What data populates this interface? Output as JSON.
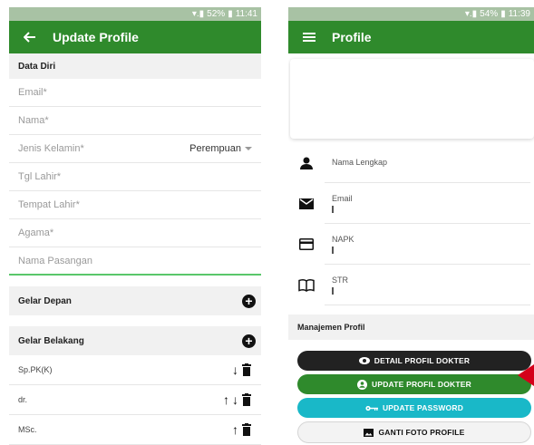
{
  "left_screen": {
    "status": {
      "battery": "52%",
      "time": "11:41"
    },
    "appbar": {
      "title": "Update Profile"
    },
    "data_diri": {
      "header": "Data Diri",
      "fields": [
        {
          "placeholder": "Email*"
        },
        {
          "placeholder": "Nama*"
        },
        {
          "placeholder": "Jenis Kelamin*",
          "value": "Perempuan"
        },
        {
          "placeholder": "Tgl Lahir*"
        },
        {
          "placeholder": "Tempat Lahir*"
        },
        {
          "placeholder": "Agama*"
        },
        {
          "placeholder": "Nama Pasangan"
        }
      ]
    },
    "gelar_depan": {
      "header": "Gelar Depan"
    },
    "gelar_belakang": {
      "header": "Gelar Belakang",
      "items": [
        {
          "label": "Sp.PK(K)"
        },
        {
          "label": "dr."
        },
        {
          "label": "MSc."
        }
      ]
    }
  },
  "right_screen": {
    "status": {
      "battery": "54%",
      "time": "11:39"
    },
    "appbar": {
      "title": "Profile"
    },
    "info": [
      {
        "label": "Nama Lengkap",
        "icon": "person-icon"
      },
      {
        "label": "Email",
        "icon": "mail-icon"
      },
      {
        "label": "NAPK",
        "icon": "card-icon"
      },
      {
        "label": "STR",
        "icon": "book-icon"
      }
    ],
    "manajemen": {
      "header": "Manajemen Profil"
    },
    "buttons": [
      {
        "label": "DETAIL PROFIL DOKTER",
        "icon": "eye-icon"
      },
      {
        "label": "UPDATE PROFIL DOKTER",
        "icon": "account-icon"
      },
      {
        "label": "UPDATE PASSWORD",
        "icon": "key-icon"
      },
      {
        "label": "GANTI FOTO PROFILE",
        "icon": "image-icon"
      }
    ]
  },
  "colors": {
    "primary": "#2f8a2c",
    "cyan": "#19b8c8",
    "dark": "#222222",
    "pointer": "#d4001a"
  }
}
